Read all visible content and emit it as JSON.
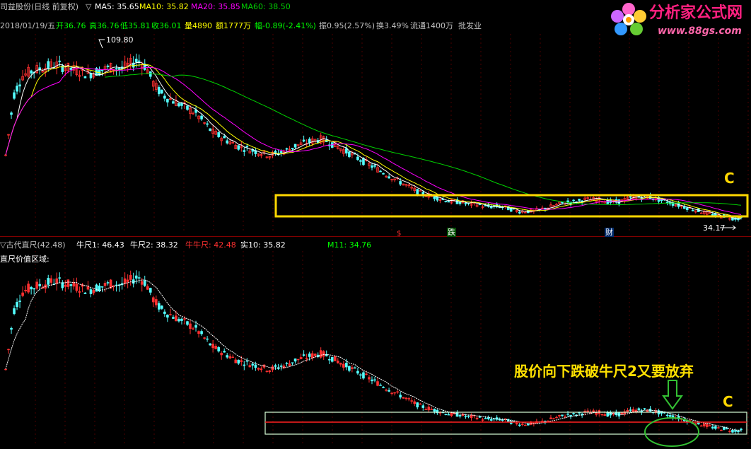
{
  "header": {
    "stock_title": "司益股份(日线 前复权)",
    "ma_triangle": "▽",
    "ma5": "MA5: 35.65",
    "ma10": "MA10: 35.82",
    "ma20": "MA20: 35.85",
    "ma60": "MA60: 38.50",
    "info_date": "2018/01/19/五",
    "info_open": "开36.76",
    "info_high": "高36.76",
    "info_low": "低35.81",
    "info_close": "收36.01",
    "info_volume": "量4890",
    "info_amount": "额1777万",
    "info_change": "幅-0.89(-2.41%)",
    "info_amplitude": "振0.95(2.57%)",
    "info_turnover": "换3.49%",
    "info_float": "流通1400万",
    "info_sector": "批发业"
  },
  "logo": {
    "name": "分析家公式网",
    "url": "www.88gs.com"
  },
  "price_panel": {
    "high_marker": "109.80",
    "low_marker": "34.17",
    "box_label": "C",
    "event_markers": [
      "$",
      "跌",
      "财"
    ]
  },
  "indicator_panel": {
    "title": "▽古代直尺(42.48)",
    "niu1": "牛尺1: 46.43",
    "niu2": "牛尺2: 38.32",
    "niuniu": "牛牛尺: 42.48",
    "shi10": "实10: 35.82",
    "m11": "M11: 34.76",
    "subtitle": "直尺价值区域:",
    "annotation": "股价向下跌破牛尺2又要放弃",
    "arrow_symbol": "⇩",
    "box_label": "C"
  },
  "colors": {
    "up_candle": "#ff3030",
    "down_candle": "#54ffff",
    "ma5": "#ffffff",
    "ma10": "#ffff00",
    "ma20": "#ff00ff",
    "ma60": "#00d000",
    "box_yellow": "#ffd700",
    "annotation_yellow": "#ffe000",
    "ellipse_green": "#33c033",
    "grid_red": "#8b0000"
  },
  "chart_data": [
    {
      "type": "candlestick",
      "title": "司益股份(日线 前复权)",
      "y_range": [
        30,
        112
      ],
      "series": [
        {
          "name": "MA5",
          "last": 35.65
        },
        {
          "name": "MA10",
          "last": 35.82
        },
        {
          "name": "MA20",
          "last": 35.85
        },
        {
          "name": "MA60",
          "last": 38.5
        }
      ],
      "last_bar": {
        "date": "2018/01/19",
        "open": 36.76,
        "high": 36.76,
        "low": 35.81,
        "close": 36.01
      },
      "annotations": [
        "109.80",
        "34.17"
      ],
      "price_path": [
        62,
        88,
        96,
        98,
        99,
        100,
        101,
        100,
        99,
        98,
        97,
        98,
        99,
        100,
        99,
        101,
        103,
        100,
        92,
        88,
        86,
        84,
        82,
        80,
        76,
        72,
        70,
        68,
        66,
        65,
        64,
        63,
        62,
        63,
        64,
        66,
        67,
        68,
        69,
        68,
        66,
        64,
        62,
        60,
        58,
        56,
        54,
        52,
        50,
        48,
        46,
        45,
        44,
        43,
        42,
        42,
        41,
        41,
        40,
        40,
        40,
        39,
        38,
        38,
        38,
        39,
        40,
        41,
        42,
        42,
        43,
        43,
        43,
        42,
        42,
        43,
        44,
        44,
        44,
        43,
        42,
        41,
        40,
        39,
        38,
        37,
        36,
        36,
        35,
        35
      ]
    },
    {
      "type": "candlestick",
      "title": "古代直尺(42.48)",
      "series": [
        {
          "name": "牛尺1",
          "value": 46.43
        },
        {
          "name": "牛尺2",
          "value": 38.32
        },
        {
          "name": "牛牛尺",
          "value": 42.48
        },
        {
          "name": "实10",
          "value": 35.82
        },
        {
          "name": "M11",
          "value": 34.76
        }
      ]
    }
  ]
}
